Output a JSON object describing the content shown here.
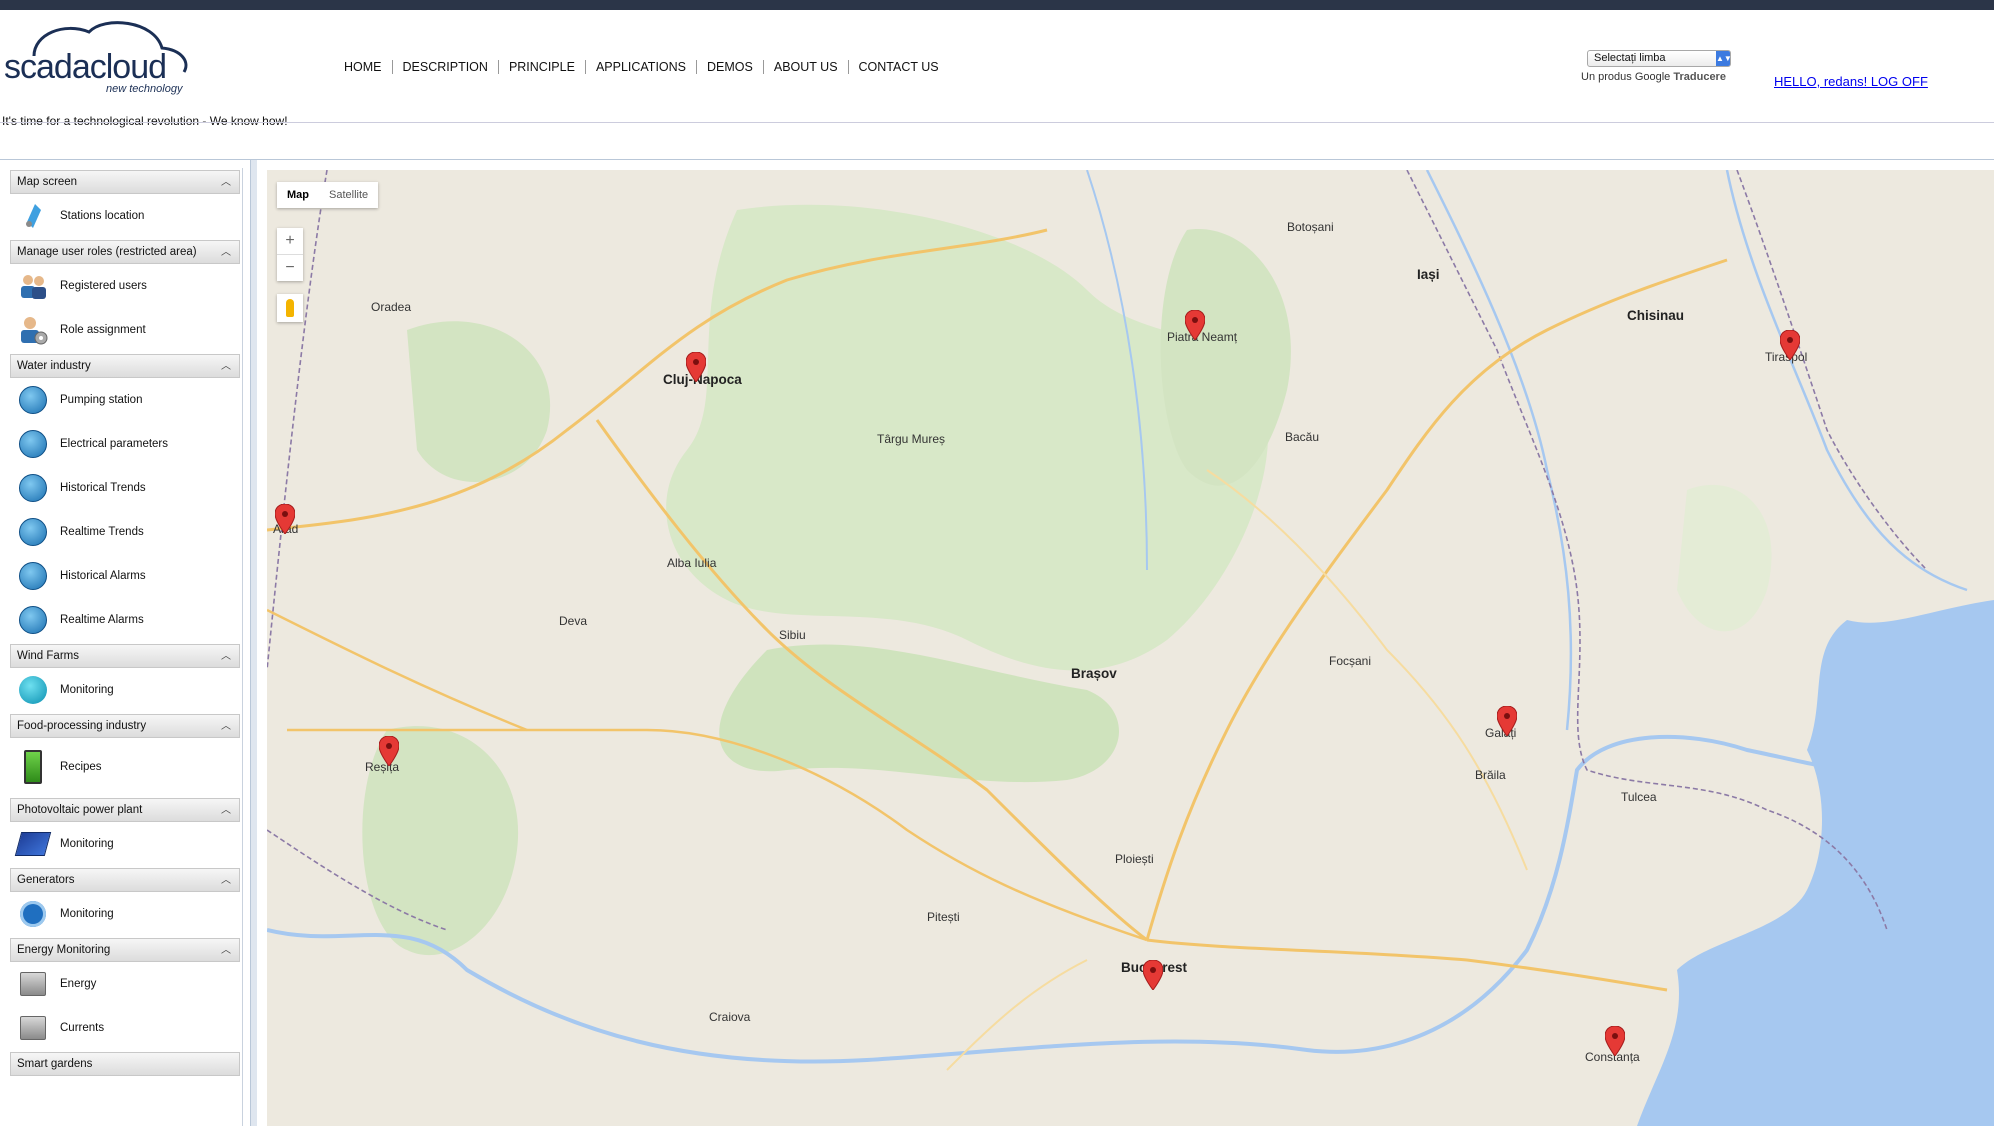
{
  "brand": {
    "name": "scadacloud",
    "sub": "new technology",
    "tagline": "It's time for a technological revolution - We know how!"
  },
  "nav": [
    "HOME",
    "DESCRIPTION",
    "PRINCIPLE",
    "APPLICATIONS",
    "DEMOS",
    "ABOUT US",
    "CONTACT US"
  ],
  "translate": {
    "select_value": "Selectați limba",
    "powered_prefix": "Un produs",
    "google": "Google",
    "product": "Traducere"
  },
  "user_link": "HELLO, redans! LOG OFF",
  "sidebar": [
    {
      "title": "Map screen",
      "items": [
        {
          "label": "Stations location",
          "icon": "pin-icon"
        }
      ]
    },
    {
      "title": "Manage user roles (restricted area)",
      "items": [
        {
          "label": "Registered users",
          "icon": "users-icon"
        },
        {
          "label": "Role assignment",
          "icon": "user-gear-icon"
        }
      ]
    },
    {
      "title": "Water industry",
      "items": [
        {
          "label": "Pumping station",
          "icon": "faucet-icon"
        },
        {
          "label": "Electrical parameters",
          "icon": "faucet-icon"
        },
        {
          "label": "Historical Trends",
          "icon": "faucet-icon"
        },
        {
          "label": "Realtime Trends",
          "icon": "faucet-icon"
        },
        {
          "label": "Historical Alarms",
          "icon": "faucet-icon"
        },
        {
          "label": "Realtime Alarms",
          "icon": "faucet-icon"
        }
      ]
    },
    {
      "title": "Wind Farms",
      "items": [
        {
          "label": "Monitoring",
          "icon": "wind-turbine-icon"
        }
      ]
    },
    {
      "title": "Food-processing industry",
      "items": [
        {
          "label": "Recipes",
          "icon": "battery-icon"
        }
      ]
    },
    {
      "title": "Photovoltaic power plant",
      "items": [
        {
          "label": "Monitoring",
          "icon": "solar-panel-icon"
        }
      ]
    },
    {
      "title": "Generators",
      "items": [
        {
          "label": "Monitoring",
          "icon": "gear-icon"
        }
      ]
    },
    {
      "title": "Energy Monitoring",
      "items": [
        {
          "label": "Energy",
          "icon": "meter-icon"
        },
        {
          "label": "Currents",
          "icon": "meter-icon"
        }
      ]
    },
    {
      "title": "Smart gardens",
      "items": []
    }
  ],
  "map": {
    "type_map": "Map",
    "type_satellite": "Satellite",
    "zoom_in": "+",
    "zoom_out": "−",
    "cities": [
      {
        "name": "Cluj-Napoca",
        "big": true
      },
      {
        "name": "Piatra Neamț",
        "big": false
      },
      {
        "name": "Tiraspol",
        "big": false
      },
      {
        "name": "Arad",
        "big": false
      },
      {
        "name": "Reșița",
        "big": false
      },
      {
        "name": "Galați",
        "big": false
      },
      {
        "name": "Bucharest",
        "big": true
      },
      {
        "name": "Constanța",
        "big": false
      },
      {
        "name": "Chisinau",
        "big": true
      },
      {
        "name": "Brașov",
        "big": true
      },
      {
        "name": "Iași",
        "big": true
      },
      {
        "name": "Oradea",
        "big": false
      },
      {
        "name": "Sibiu",
        "big": false
      },
      {
        "name": "Craiova",
        "big": false
      },
      {
        "name": "Pitești",
        "big": false
      },
      {
        "name": "Ploiești",
        "big": false
      },
      {
        "name": "Bacău",
        "big": false
      },
      {
        "name": "Focșani",
        "big": false
      },
      {
        "name": "Brăila",
        "big": false
      },
      {
        "name": "Tulcea",
        "big": false
      },
      {
        "name": "Târgu Mureș",
        "big": false
      },
      {
        "name": "Alba Iulia",
        "big": false
      },
      {
        "name": "Deva",
        "big": false
      },
      {
        "name": "Botoșani",
        "big": false
      }
    ]
  }
}
